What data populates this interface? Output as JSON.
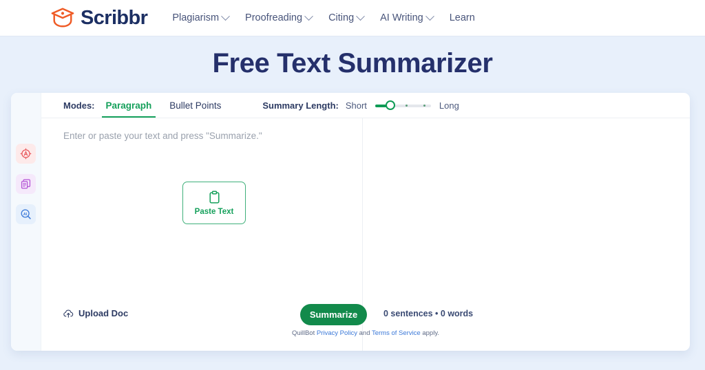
{
  "header": {
    "brand": "Scribbr",
    "logo_icon": "graduation-cap-icon",
    "brand_color": "#ef5b26",
    "nav": [
      {
        "label": "Plagiarism",
        "has_caret": true
      },
      {
        "label": "Proofreading",
        "has_caret": true
      },
      {
        "label": "Citing",
        "has_caret": true
      },
      {
        "label": "AI Writing",
        "has_caret": true
      },
      {
        "label": "Learn",
        "has_caret": false
      }
    ]
  },
  "page_title": "Free Text Summarizer",
  "rail": {
    "items": [
      {
        "icon": "plagiarism-checker-icon",
        "color": "#e8595d",
        "bg": "#fdeaea"
      },
      {
        "icon": "paraphraser-document-icon",
        "color": "#b455d6",
        "bg": "#f5e9fb"
      },
      {
        "icon": "ai-detector-magnifier-icon",
        "color": "#3a78d8",
        "bg": "#e6f0fc"
      }
    ]
  },
  "toolbar": {
    "modes_label": "Modes:",
    "modes": [
      {
        "label": "Paragraph",
        "active": true
      },
      {
        "label": "Bullet Points",
        "active": false
      }
    ],
    "summary_length_label": "Summary Length:",
    "short_label": "Short",
    "long_label": "Long",
    "slider_value": 1,
    "slider_max": 4,
    "accent_green": "#15a05b"
  },
  "editor": {
    "placeholder": "Enter or paste your text and press \"Summarize.\"",
    "paste_button": {
      "label": "Paste Text",
      "icon": "clipboard-icon"
    }
  },
  "bottom": {
    "upload_label": "Upload Doc",
    "upload_icon": "cloud-upload-icon",
    "summarize_label": "Summarize",
    "counts": "0 sentences • 0 words",
    "legal": {
      "prefix": "QuillBot ",
      "privacy": "Privacy Policy",
      "middle": " and ",
      "terms": "Terms of Service",
      "suffix": " apply."
    }
  }
}
